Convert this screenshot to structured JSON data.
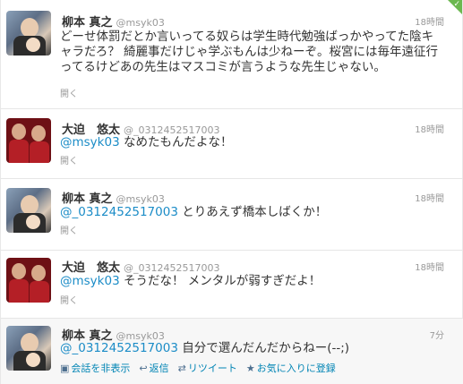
{
  "tweets": [
    {
      "name": "柳本 真之",
      "handle": "@msyk03",
      "time": "18時間",
      "text": "どーせ体罰だとか言いってる奴らは学生時代勉強ばっかやってた陰キャラだろ？ 綺麗事だけじゃ学ぶもんは少ねーぞ。桜宮には毎年遠征行ってるけどあの先生はマスコミが言うような先生じゃない。",
      "expand": "開く"
    },
    {
      "name": "大迫　悠太",
      "handle": "@_0312452517003",
      "time": "18時間",
      "mention": "@msyk03",
      "text": " なめたもんだよな！",
      "expand": "開く"
    },
    {
      "name": "柳本 真之",
      "handle": "@msyk03",
      "time": "18時間",
      "mention": "@_0312452517003",
      "text": " とりあえず橋本しばくか！",
      "expand": "開く"
    },
    {
      "name": "大迫　悠太",
      "handle": "@_0312452517003",
      "time": "18時間",
      "mention": "@msyk03",
      "text": " そうだな！ メンタルが弱すぎだよ！",
      "expand": "開く"
    },
    {
      "name": "柳本 真之",
      "handle": "@msyk03",
      "time": "7分",
      "mention": "@_0312452517003",
      "text": " 自分で選んだんだからねー(--;)",
      "actions": {
        "hide": "会話を非表示",
        "reply": "返信",
        "retweet": "リツイート",
        "favorite": "お気に入りに登録"
      }
    }
  ],
  "icons": {
    "hide": "chat-icon",
    "reply": "reply-icon",
    "retweet": "retweet-icon",
    "favorite": "star-icon"
  },
  "colors": {
    "link": "#1b8cc7",
    "corner_flag": "#6cb850"
  }
}
